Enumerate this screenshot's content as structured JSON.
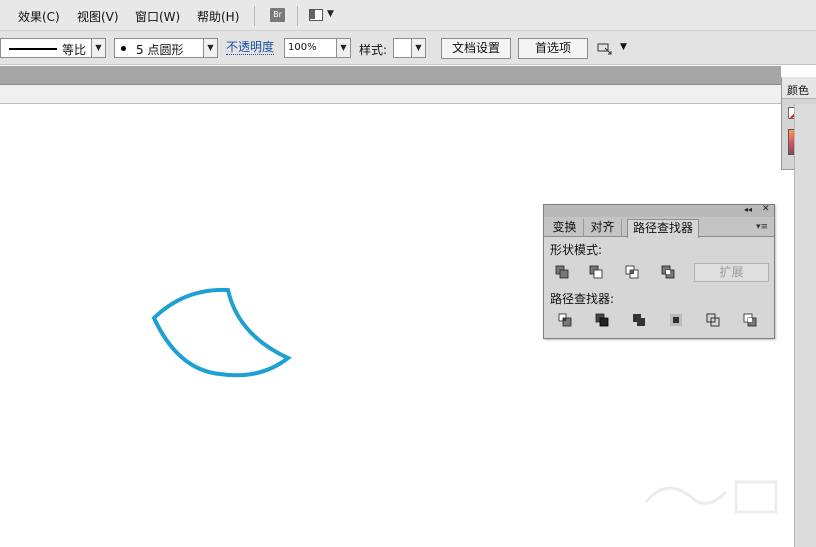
{
  "menubar": {
    "items": [
      "效果(C)",
      "视图(V)",
      "窗口(W)",
      "帮助(H)"
    ],
    "bridge_label": "Br"
  },
  "controlbar": {
    "stroke_profile": "等比",
    "brush_value": "5 点圆形",
    "opacity_label": "不透明度",
    "opacity_value": "100%",
    "style_label": "样式:",
    "document_setup_button": "文档设置",
    "preferences_button": "首选项"
  },
  "color_panel": {
    "title": "颜色"
  },
  "pathfinder_panel": {
    "tabs": [
      "变换",
      "对齐",
      "路径查找器"
    ],
    "active_tab": "路径查找器",
    "shape_modes_label": "形状模式:",
    "expand_button": "扩展",
    "pathfinders_label": "路径查找器:"
  },
  "artwork": {
    "stroke_color": "#1ea0d3"
  },
  "icons": [
    "bridge-icon",
    "workspace-switcher-icon",
    "chevron-down-icon",
    "isolate-icon",
    "collapse-icon",
    "close-icon",
    "panel-menu-icon",
    "unite-icon",
    "minus-front-icon",
    "intersect-icon",
    "exclude-icon",
    "divide-icon",
    "trim-icon",
    "merge-icon",
    "crop-icon",
    "outline-icon",
    "minus-back-icon"
  ]
}
